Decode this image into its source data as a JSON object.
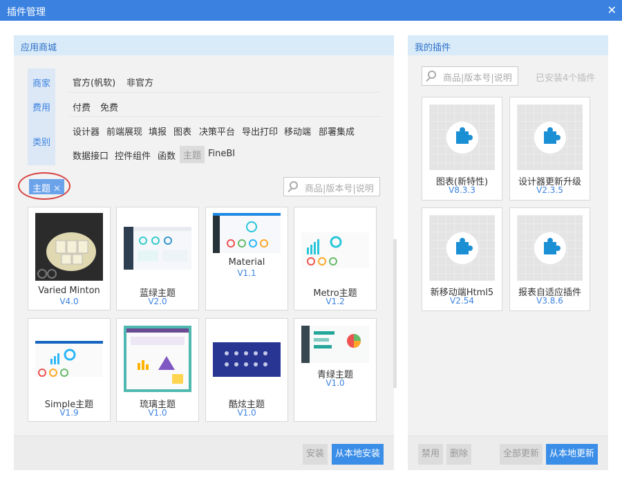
{
  "window": {
    "title": "插件管理",
    "close_glyph": "✕"
  },
  "store": {
    "header": "应用商城",
    "filters": {
      "vendor": {
        "label": "商家",
        "options": [
          "官方(帆软)",
          "非官方"
        ]
      },
      "fee": {
        "label": "费用",
        "options": [
          "付费",
          "免费"
        ]
      },
      "category": {
        "label": "类别",
        "options_row1": [
          "设计器",
          "前端展现",
          "填报",
          "图表",
          "决策平台",
          "导出打印",
          "移动端",
          "部署集成"
        ],
        "options_row2": [
          "数据接口",
          "控件组件",
          "函数",
          "主题",
          "FineBI"
        ],
        "active": "主题"
      }
    },
    "active_tag": {
      "label": "主题",
      "remove_glyph": "✕"
    },
    "search_placeholder": "商品|版本号|说明",
    "items": [
      {
        "name": "Varied Minton",
        "version": "V4.0"
      },
      {
        "name": "蓝绿主题",
        "version": "V2.0"
      },
      {
        "name": "Material",
        "version": "V1.1"
      },
      {
        "name": "Metro主题",
        "version": "V1.2"
      },
      {
        "name": "Simple主题",
        "version": "V1.9"
      },
      {
        "name": "琉璃主题",
        "version": "V1.0"
      },
      {
        "name": "酷炫主题",
        "version": "V1.0"
      },
      {
        "name": "青绿主题",
        "version": "V1.0"
      }
    ],
    "footer": {
      "install": "安装",
      "install_local": "从本地安装"
    }
  },
  "mine": {
    "header": "我的插件",
    "search_placeholder": "商品|版本号|说明",
    "installed_count": "已安装4个插件",
    "items": [
      {
        "name": "图表(新特性)",
        "version": "V8.3.3",
        "icon": "puzzle-icon"
      },
      {
        "name": "设计器更新升级",
        "version": "V2.3.5",
        "icon": "puzzle-icon"
      },
      {
        "name": "新移动端Html5",
        "version": "V2.54",
        "icon": "puzzle-icon"
      },
      {
        "name": "报表自适应插件",
        "version": "V3.8.6",
        "icon": "puzzle-icon"
      }
    ],
    "footer": {
      "disable": "禁用",
      "delete": "删除",
      "update_all": "全部更新",
      "update_local": "从本地更新"
    }
  },
  "colors": {
    "titlebar": "#3b82e0",
    "accent": "#3b82e0",
    "button_blue": "#3b8ee8",
    "panel_head": "#d9eaf9",
    "puzzle": "#1b8fd4",
    "highlight_ring": "#d6413f"
  }
}
